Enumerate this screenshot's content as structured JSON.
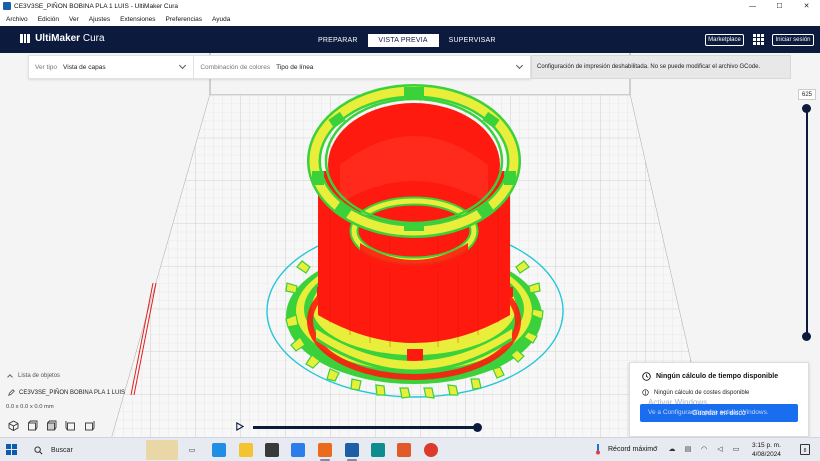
{
  "window": {
    "title": "CE3V3SE_PIÑON BOBINA PLA 1 LUIS - UltiMaker Cura",
    "minimize_glyph": "—",
    "maximize_glyph": "☐",
    "close_glyph": "✕"
  },
  "menu": [
    "Archivo",
    "Edición",
    "Ver",
    "Ajustes",
    "Extensiones",
    "Preferencias",
    "Ayuda"
  ],
  "header": {
    "brand_bold": "UltiMaker",
    "brand_rest": " Cura",
    "stages": [
      {
        "label": "PREPARAR",
        "active": false
      },
      {
        "label": "VISTA PREVIA",
        "active": true
      },
      {
        "label": "SUPERVISAR",
        "active": false
      }
    ],
    "marketplace_label": "Marketplace",
    "signin_label": "Iniciar sesión"
  },
  "viewbar": {
    "view_type_label": "Ver tipo",
    "view_type_value": "Vista de capas",
    "color_scheme_label": "Combinación de colores",
    "color_scheme_value": "Tipo de línea",
    "gcode_message": "Configuración de impresión deshabilitada. No se puede modificar el archivo GCode."
  },
  "layer_slider": {
    "current_layer": "625",
    "top_fraction": 1.0,
    "bottom_fraction": 0.0
  },
  "objects": {
    "header": "Lista de objetos",
    "item_name": "CE3V3SE_PIÑON BOBINA PLA 1 LUIS",
    "dimensions": "0.0 x 0.0 x 0.0 mm"
  },
  "simulation": {
    "progress": 1.0
  },
  "print_info": {
    "time_text": "Ningún cálculo de tiempo disponible",
    "cost_text": "Ningún cálculo de costes disponible",
    "save_label": "Guardar en disco",
    "watermark_line1": "Activar Windows",
    "watermark_line2": "Ve a Configuración para activar Windows."
  },
  "taskbar": {
    "search_label": "Buscar",
    "weather_text": "Récord máximo",
    "time": "3:15 p. m.",
    "date": "4/08/2024",
    "notifications": "8"
  },
  "colors": {
    "header_bg": "#0b1a3d",
    "accent_blue": "#196ef0",
    "model_red": "#ff1a10",
    "model_yellow": "#e8ee3a",
    "model_green": "#3bd13b",
    "build_outline": "#22c8d8"
  }
}
